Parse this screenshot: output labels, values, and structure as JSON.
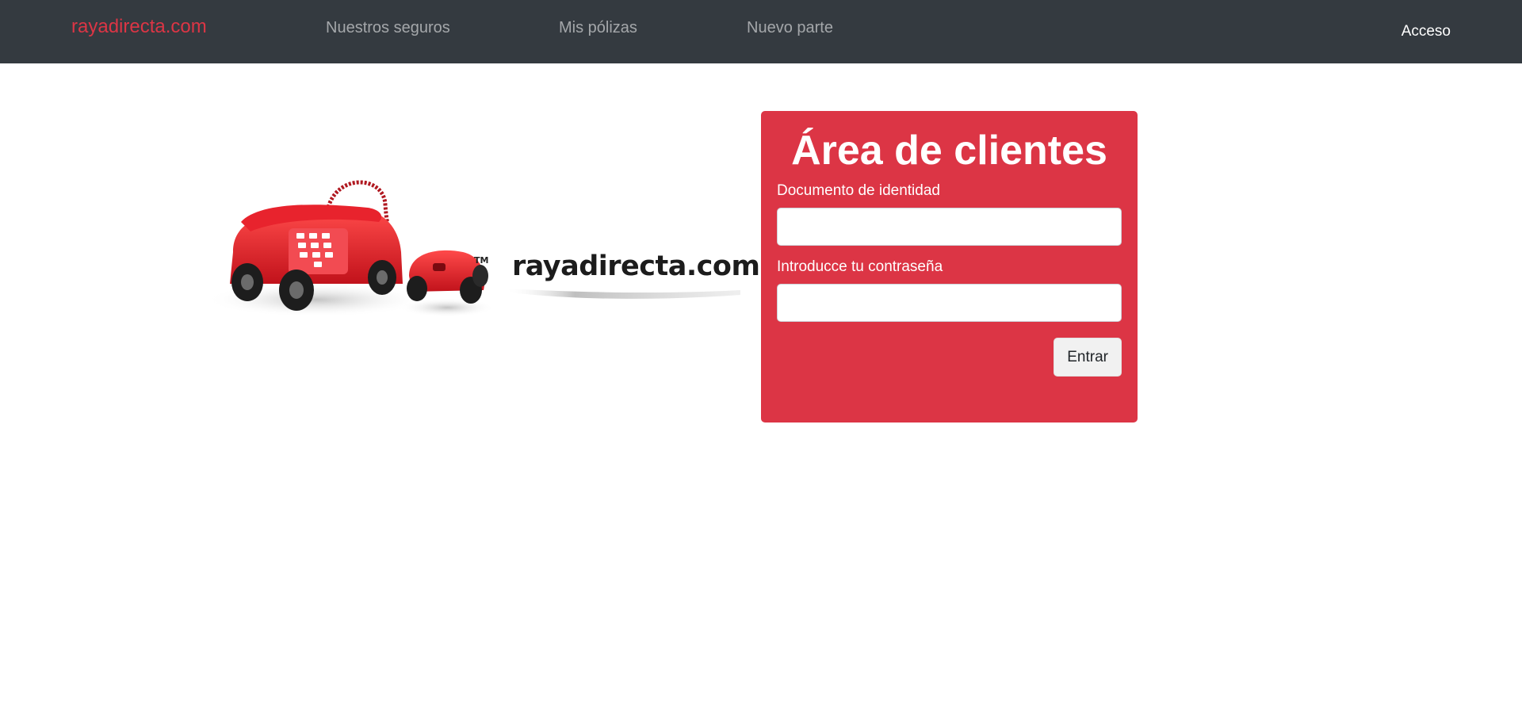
{
  "navbar": {
    "brand": "rayadirecta.com",
    "links": [
      "Nuestros seguros",
      "Mis pólizas",
      "Nuevo parte"
    ],
    "access": "Acceso",
    "brand_color": "#dc3545",
    "background_color": "#343a40"
  },
  "logo": {
    "text": "rayadirecta.com",
    "trademark": "TM"
  },
  "login": {
    "title": "Área de clientes",
    "id_label": "Documento de identidad",
    "id_value": "",
    "password_label": "Introducce tu contraseña",
    "password_value": "",
    "submit_label": "Entrar",
    "card_color": "#dc3545"
  }
}
